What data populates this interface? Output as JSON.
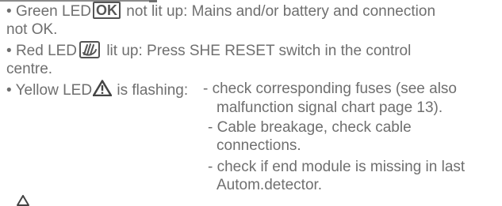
{
  "items": {
    "green_bullet": "•",
    "green_pre": "Green LED",
    "green_icon_text": "OK",
    "green_post": "not lit up: Mains and/or battery and connection",
    "green_cont": "not OK.",
    "red_bullet": "•",
    "red_pre": "Red LED",
    "red_post": "lit up: Press SHE RESET switch in the control",
    "red_cont": "centre.",
    "yellow_bullet": "•",
    "yellow_pre": "Yellow LED",
    "yellow_post": "is flashing:",
    "check1_a": "- check corresponding fuses (see also",
    "check1_b": "malfunction signal chart page 13).",
    "check2_a": "- Cable breakage, check cable",
    "check2_b": "connections.",
    "check3_a": "- check if end module is missing in last",
    "check3_b": "Autom.detector."
  },
  "colors": {
    "text": "#6f6f6f",
    "icon": "#555555"
  },
  "icons": {
    "ok": "ok-box-icon",
    "reset": "reset-hand-icon",
    "warning": "warning-triangle-icon"
  }
}
